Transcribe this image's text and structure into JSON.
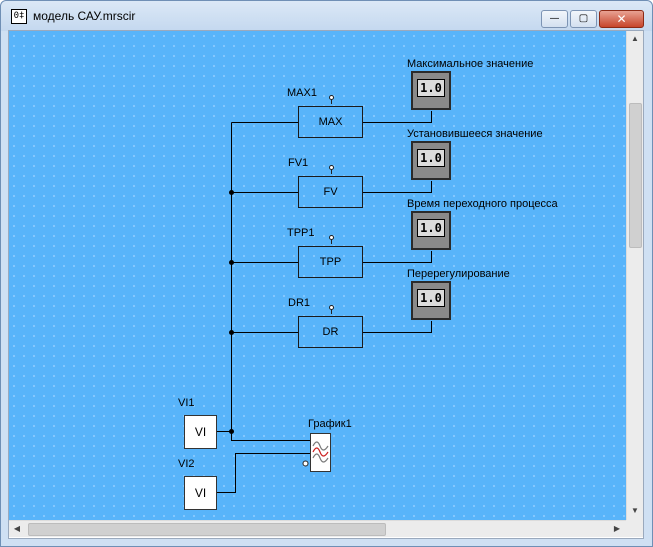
{
  "window": {
    "title": "модель САУ.mrscir",
    "icon_text": "0‡",
    "minimize_glyph": "—",
    "maximize_glyph": "▢",
    "close_glyph": "✕"
  },
  "blocks": [
    {
      "id": "max",
      "label": "MAX1",
      "text": "MAX"
    },
    {
      "id": "fv",
      "label": "FV1",
      "text": "FV"
    },
    {
      "id": "tpp",
      "label": "TPP1",
      "text": "TPP"
    },
    {
      "id": "dr",
      "label": "DR1",
      "text": "DR"
    }
  ],
  "displays": [
    {
      "caption": "Максимальное значение",
      "value": "1.0"
    },
    {
      "caption": "Установившееся значение",
      "value": "1.0"
    },
    {
      "caption": "Время переходного процесса",
      "value": "1.0"
    },
    {
      "caption": "Перерегулирование",
      "value": "1.0"
    }
  ],
  "sources": [
    {
      "label": "VI1",
      "text": "VI"
    },
    {
      "label": "VI2",
      "text": "VI"
    }
  ],
  "graph": {
    "label": "График1",
    "icon": "waveform-icon"
  },
  "colors": {
    "canvas": "#58b4fa",
    "block_fill": "#58b4fa",
    "wire": "#000000"
  },
  "scrollbars": {
    "up_arrow": "▲",
    "down_arrow": "▼",
    "left_arrow": "◀",
    "right_arrow": "▶"
  }
}
